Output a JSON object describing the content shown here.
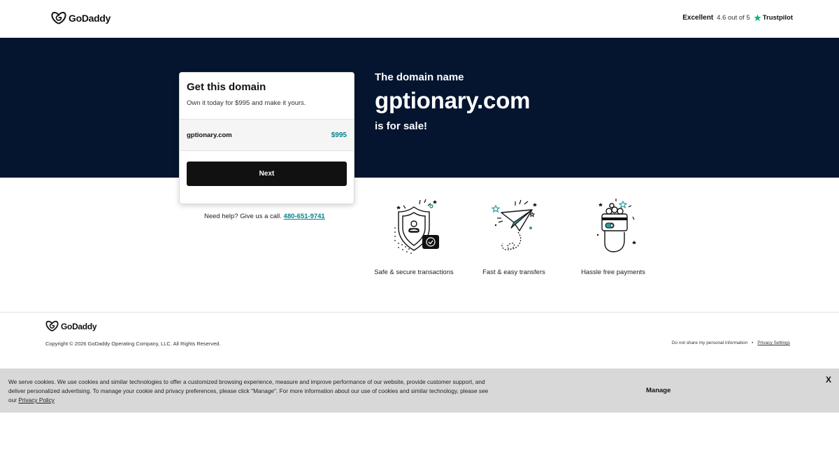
{
  "header": {
    "brand": "GoDaddy",
    "trust_rating_word": "Excellent",
    "trust_score": "4.6 out of 5",
    "trust_brand": "Trustpilot"
  },
  "hero": {
    "intro": "The domain name",
    "domain": "gptionary.com",
    "sale_text": "is for sale!"
  },
  "card": {
    "title": "Get this domain",
    "subtitle": "Own it today for $995 and make it yours.",
    "domain": "gptionary.com",
    "price": "$995",
    "next_label": "Next"
  },
  "help": {
    "text": "Need help? Give us a call.",
    "phone": "480-651-9741"
  },
  "features": [
    {
      "label": "Safe & secure transactions",
      "icon": "shield-icon"
    },
    {
      "label": "Fast & easy transfers",
      "icon": "paper-plane-icon"
    },
    {
      "label": "Hassle free payments",
      "icon": "payment-card-icon"
    }
  ],
  "footer": {
    "brand": "GoDaddy",
    "copyright": "Copyright © 2026 GoDaddy Operating Company, LLC. All Rights Reserved.",
    "do_not_share": "Do not share my personal information",
    "separator": "•",
    "privacy_settings": "Privacy Settings"
  },
  "cookie": {
    "text": "We serve cookies. We use cookies and similar technologies to offer a customized browsing experience, measure and improve performance of our website, provide customer support, and deliver personalized advertising. To manage your cookie and privacy preferences, please click \"Manage\". For more information about our use of cookies and similar technology, please see our",
    "policy_link": "Privacy Policy",
    "manage_label": "Manage",
    "close_label": "X"
  },
  "colors": {
    "hero_bg": "#051530",
    "accent_teal": "#00838c",
    "button_bg": "#111111",
    "cookie_bg": "#d8d8d8"
  }
}
